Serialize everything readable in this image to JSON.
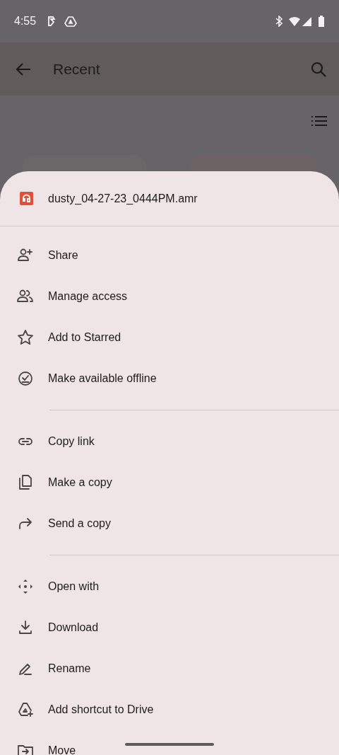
{
  "status_bar": {
    "time": "4:55"
  },
  "app_bar": {
    "title": "Recent"
  },
  "sheet": {
    "file_name": "dusty_04-27-23_0444PM.amr",
    "sections": [
      {
        "items": [
          {
            "label": "Share"
          },
          {
            "label": "Manage access"
          },
          {
            "label": "Add to Starred"
          },
          {
            "label": "Make available offline"
          }
        ]
      },
      {
        "items": [
          {
            "label": "Copy link"
          },
          {
            "label": "Make a copy"
          },
          {
            "label": "Send a copy"
          }
        ]
      },
      {
        "items": [
          {
            "label": "Open with"
          },
          {
            "label": "Download"
          },
          {
            "label": "Rename"
          },
          {
            "label": "Add shortcut to Drive"
          },
          {
            "label": "Move"
          }
        ]
      }
    ]
  }
}
